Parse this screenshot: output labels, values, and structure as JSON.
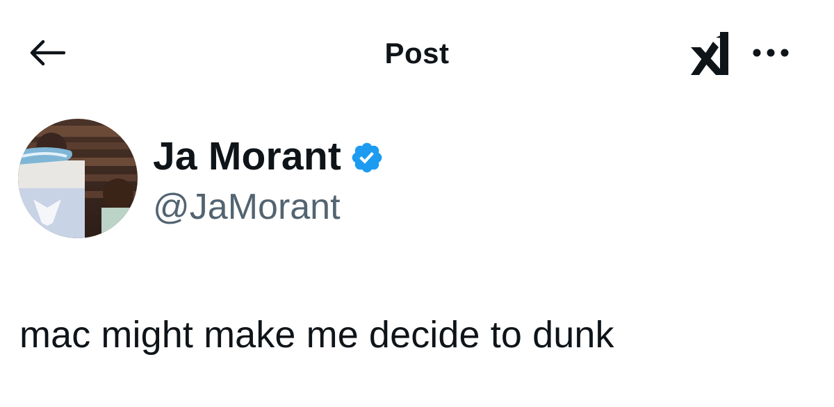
{
  "header": {
    "title": "Post",
    "back_icon": "arrow-left-icon",
    "grok_icon": "grok-icon",
    "more_icon": "more-horizontal-icon"
  },
  "author": {
    "display_name": "Ja Morant",
    "handle": "@JaMorant",
    "verified": true,
    "verified_color": "#1d9bf0"
  },
  "post": {
    "text": "mac might make me decide to dunk"
  },
  "colors": {
    "text_primary": "#0f1419",
    "text_secondary": "#536471",
    "background": "#ffffff"
  }
}
